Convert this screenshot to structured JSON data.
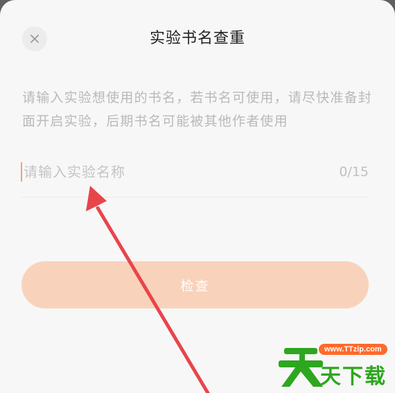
{
  "dialog": {
    "title": "实验书名查重",
    "description": "请输入实验想使用的书名，若书名可使用，请尽快准备封面开启实验，后期书名可能被其他作者使用",
    "input": {
      "placeholder": "请输入实验名称",
      "value": "",
      "counter": "0/15"
    },
    "check_button_label": "检查"
  },
  "icons": {
    "close": "close-icon",
    "annotation": "red-arrow-annotation",
    "logo": "ttzip-logo-icon"
  },
  "colors": {
    "accent": "#f9d2bb",
    "caret": "#f2a07a",
    "arrow": "#e8454a",
    "watermark_green": "#2ea61f",
    "watermark_orange": "#ff6a2a"
  },
  "watermark": {
    "url": "www.TTzip.com",
    "text": "天下载"
  }
}
